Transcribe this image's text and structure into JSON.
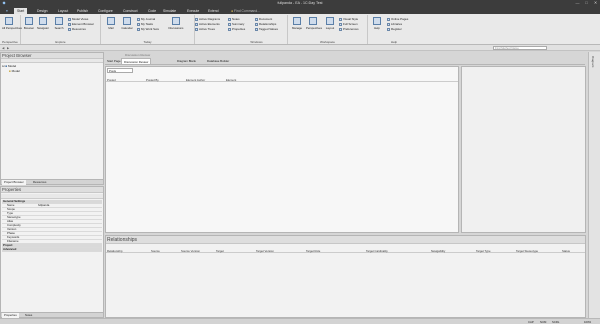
{
  "title": "fullpanda - EA - 1C:Day Test",
  "window_controls": [
    "—",
    "□",
    "✕"
  ],
  "tabs": [
    "Start",
    "Design",
    "Layout",
    "Publish",
    "Configure",
    "Construct",
    "Code",
    "Simulate",
    "Execute",
    "Extend"
  ],
  "active_tab": "Start",
  "find_command": "Find Command...",
  "ribbon": {
    "perspective": {
      "label": "Perspective",
      "buttons": [
        "All Perspectives",
        "Browser",
        "Navigator",
        "Search"
      ]
    },
    "explore": {
      "label": "Explore",
      "items": [
        "Model Views",
        "Element Browser",
        "Resources"
      ]
    },
    "mail": "Mail",
    "calendar": "Calendar",
    "today": {
      "label": "Today",
      "items": [
        "My Journal",
        "My Tasks",
        "My Work Sets"
      ],
      "discuss": "Discussions"
    },
    "diagrams": {
      "items": [
        "Active Diagrams",
        "Active Elements",
        "Active Trees"
      ]
    },
    "windows": {
      "label": "Windows",
      "items": [
        "Notes",
        "Summary",
        "Properties",
        "Document",
        "Relationships",
        "Tagged Values"
      ]
    },
    "workspace": {
      "label": "Workspace",
      "buttons": [
        "Manage",
        "Perspectives",
        "Layout"
      ],
      "items": [
        "Visual Style",
        "Full Screen",
        "Preferences"
      ]
    },
    "help": {
      "label": "Help",
      "button": "Help",
      "items": [
        "Online Pages",
        "Libraries",
        "Register"
      ]
    }
  },
  "search_placeholder": "Find Method Name",
  "project_browser": {
    "title": "Project Browser",
    "root": "Model",
    "child": "Model",
    "tabs": [
      "Project Browser",
      "Resources"
    ]
  },
  "properties": {
    "title": "Properties",
    "rows": [
      {
        "k": "General Settings",
        "v": "",
        "cat": true
      },
      {
        "k": "Name",
        "v": "fullpanda",
        "cat": false
      },
      {
        "k": "Scope",
        "v": "",
        "cat": false
      },
      {
        "k": "Type",
        "v": "",
        "cat": false
      },
      {
        "k": "Stereotype",
        "v": "",
        "cat": false
      },
      {
        "k": "Alias",
        "v": "",
        "cat": false
      },
      {
        "k": "Complexity",
        "v": "",
        "cat": false
      },
      {
        "k": "Version",
        "v": "",
        "cat": false
      },
      {
        "k": "Phase",
        "v": "",
        "cat": false
      },
      {
        "k": "Keywords",
        "v": "",
        "cat": false
      },
      {
        "k": "Filename",
        "v": "",
        "cat": false
      },
      {
        "k": "Project",
        "v": "",
        "cat": true
      },
      {
        "k": "Advanced",
        "v": "",
        "cat": true
      }
    ],
    "tabs": [
      "Properties",
      "Notes"
    ]
  },
  "center": {
    "header": "Discussion Review",
    "tabs": [
      "Start Page",
      "Discussion Review",
      "Diagram Blank",
      "Database Builder"
    ],
    "filter_label": "Posts",
    "columns": [
      "Posted",
      "Posted By",
      "Element Author",
      "Element"
    ]
  },
  "relationships": {
    "title": "Relationships",
    "columns": [
      "Relationship",
      "Source",
      "Source Version",
      "Target",
      "Target Version",
      "Target Role",
      "Target Cardinality",
      "Navigability",
      "Target Type",
      "Target Stereotype",
      "Status"
    ]
  },
  "right_edge": "Diagram",
  "status": {
    "text": "",
    "caps": "CAP",
    "num": "NUM",
    "scrl": "SCRL",
    "zoom": "100%"
  }
}
